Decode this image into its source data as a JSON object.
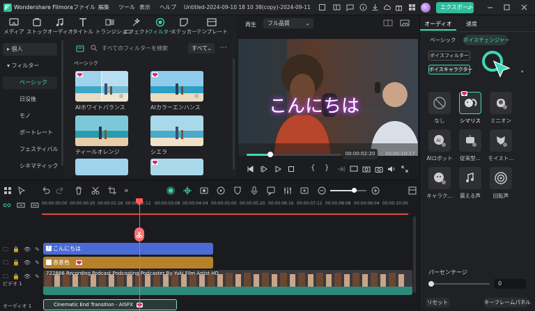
{
  "titlebar": {
    "app_name": "Wondershare Filmora",
    "menu": [
      "ファイル",
      "編集",
      "ツール",
      "表示",
      "ヘルプ"
    ],
    "project_title": "Untitled-2024-09-10 18 10 38(copy)-2024-09-11 15 0...",
    "export_label": "エクスポート"
  },
  "tabs": [
    "メディア",
    "ストック",
    "オーディオ",
    "タイトル",
    "トランジション",
    "エフェクト",
    "フィルター",
    "ステッカー",
    "テンプレート"
  ],
  "active_tab": "フィルター",
  "sidebar": {
    "items": [
      "個人",
      "フィルター",
      "ベーシック",
      "日没後",
      "モノ",
      "ポートレート",
      "フェスティバル",
      "シネマティック"
    ],
    "selected": "ベーシック"
  },
  "filters": {
    "search_placeholder": "すべてのフィルターを検索",
    "dropdown": "すべて",
    "section": "ベーシック",
    "items": [
      "AIホワイトバランス",
      "AIカラーエンハンス",
      "ティールオレンジ",
      "シエラ"
    ]
  },
  "preview": {
    "label": "再生",
    "quality": "フル品質",
    "overlay_text": "こんにちは",
    "current_time": "00:00:02:20",
    "separator": "/",
    "total_time": "00:00:10:17"
  },
  "timeline": {
    "ruler": [
      "00:00:00:00",
      "00:00:00:20",
      "00:00:01:16",
      "00:00:02:12",
      "00:00:03:08",
      "00:00:04:04",
      "00:00:05:00",
      "00:00:05:20",
      "00:00:06:16",
      "00:00:07:12",
      "00:00:08:08",
      "00:00:09:04",
      "00:00:10:00"
    ],
    "clips": {
      "title": "こんにちは",
      "audio_fx": "赤茶色",
      "video": "722866 Recording Podcast Podcasting Podcaster By Yuki Film Artist HD",
      "transition": "Cinematic End Transition - AISFX"
    },
    "track_labels": [
      "ビデオ 1",
      "オーディオ 1"
    ]
  },
  "right_panel": {
    "tabs": [
      "オーディオ",
      "速度"
    ],
    "subtabs": [
      "ベーシック",
      "ボイスチェンジャー"
    ],
    "buttons": [
      "ボイスフィルター",
      "ボイスキャラクター"
    ],
    "voices": [
      "なし",
      "シマリス",
      "ミニオン",
      "AIロボット",
      "従来型...",
      "モイスト...",
      "キャラク...",
      "震える声",
      "回転声"
    ],
    "selected_voice": "シマリス",
    "percentage_label": "パーセンテージ",
    "percentage_value": "0",
    "reset_label": "リセット",
    "keyframe_label": "キーフレームパネル"
  },
  "colors": {
    "accent": "#3fd9b7",
    "title_clip": "#4a6bd6",
    "audio_clip": "#b5822a",
    "playhead": "#ff5a5a"
  }
}
